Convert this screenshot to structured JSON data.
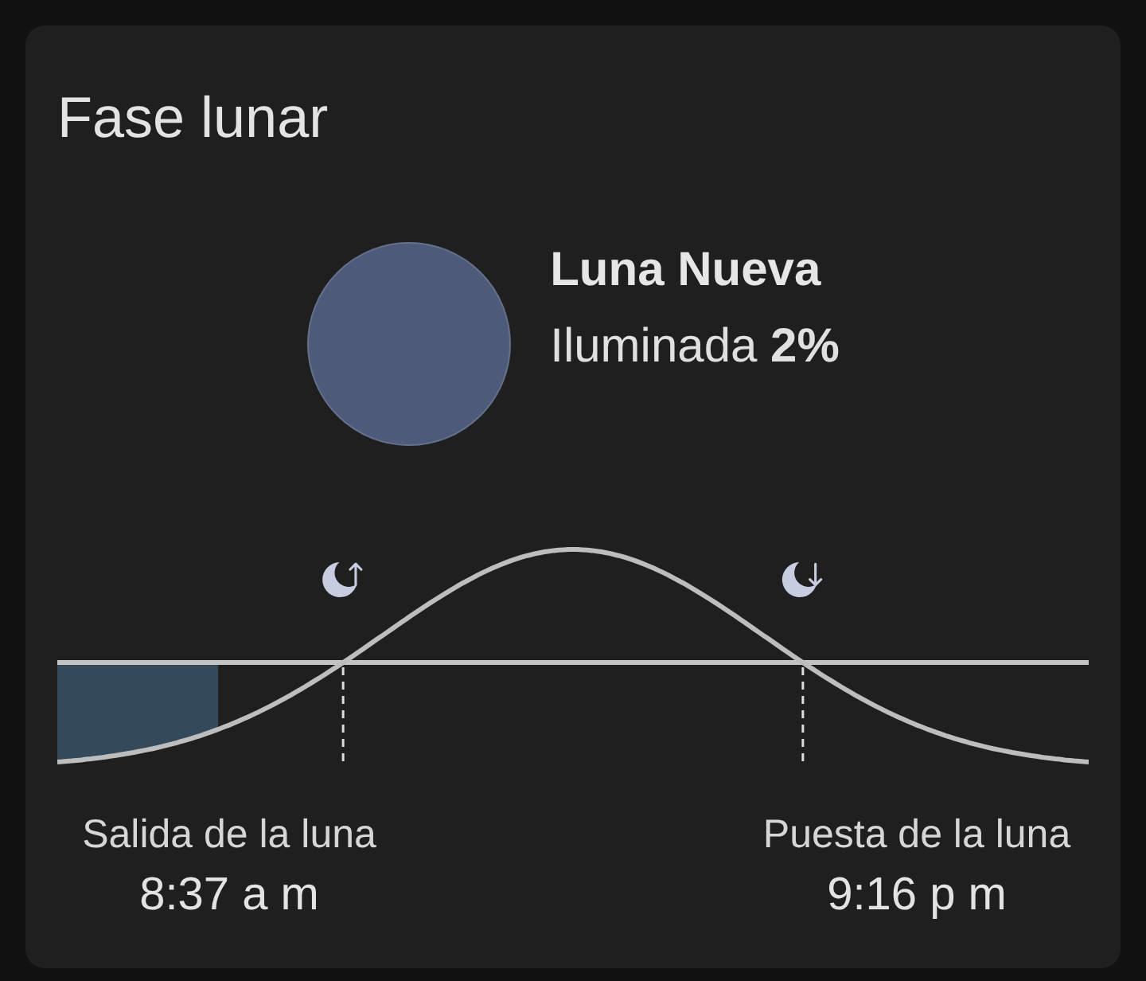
{
  "card": {
    "title": "Fase lunar"
  },
  "moon": {
    "phase": "Luna Nueva",
    "illumination": "Iluminada **2%**"
  },
  "sky_track": {
    "level": 0.156
  },
  "events": [
    {
      "kind": "rise",
      "label": "Salida de la luna",
      "time": "8:37 a m"
    },
    {
      "kind": "set",
      "label": "Puesta de la luna",
      "time": "9:16 p m"
    }
  ]
}
